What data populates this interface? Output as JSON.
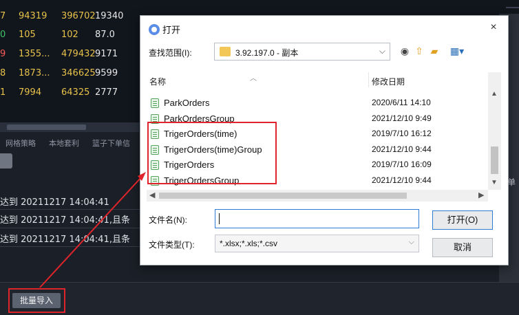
{
  "background": {
    "table_rows": [
      {
        "c0": "7",
        "c1": "94319",
        "c2": "396702",
        "c3": "19340",
        "c0_color": "yel",
        "c1_color": "yel",
        "c2_color": "yel"
      },
      {
        "c0": "0",
        "c1": "105",
        "c2": "102",
        "c3": "87.0",
        "c0_color": "grn",
        "c1_color": "yel",
        "c2_color": "yel"
      },
      {
        "c0": "9",
        "c1": "1355...",
        "c2": "479432",
        "c3": "9171",
        "c0_color": "up",
        "c1_color": "yel",
        "c2_color": "yel"
      },
      {
        "c0": "8",
        "c1": "1873...",
        "c2": "346625",
        "c3": "9599",
        "c0_color": "yel",
        "c1_color": "yel",
        "c2_color": "yel"
      },
      {
        "c0": "1",
        "c1": "7994",
        "c2": "64325",
        "c3": "2777",
        "c0_color": "yel",
        "c1_color": "yel",
        "c2_color": "yel"
      }
    ],
    "tabs": [
      "网格策略",
      "本地套利",
      "篮子下单信"
    ],
    "messages": [
      "达到 20211217 14:04:41",
      "达到 20211217 14:04:41,且条",
      "达到 20211217 14:04:41,且条"
    ],
    "import_button": "批量导入",
    "right_edge_text": "单"
  },
  "dialog": {
    "title": "打开",
    "close": "×",
    "look_in_label": "查找范围(I):",
    "look_in_value": "3.92.197.0 - 副本",
    "columns": {
      "name": "名称",
      "date": "修改日期"
    },
    "files": [
      {
        "name": "ParkOrders",
        "date": "2020/6/11 14:10"
      },
      {
        "name": "ParkOrdersGroup",
        "date": "2021/12/10 9:49"
      },
      {
        "name": "TrigerOrders(time)",
        "date": "2019/7/10 16:12"
      },
      {
        "name": "TrigerOrders(time)Group",
        "date": "2021/12/10 9:44"
      },
      {
        "name": "TrigerOrders",
        "date": "2019/7/10 16:09"
      },
      {
        "name": "TrigerOrdersGroup",
        "date": "2021/12/10 9:44"
      }
    ],
    "filename_label": "文件名(N):",
    "filename_value": "",
    "filetype_label": "文件类型(T):",
    "filetype_value": "*.xlsx;*.xls;*.csv",
    "open_button": "打开(O)",
    "cancel_button": "取消"
  },
  "colors": {
    "highlight": "#e0242b",
    "accent": "#2b7bd4"
  }
}
